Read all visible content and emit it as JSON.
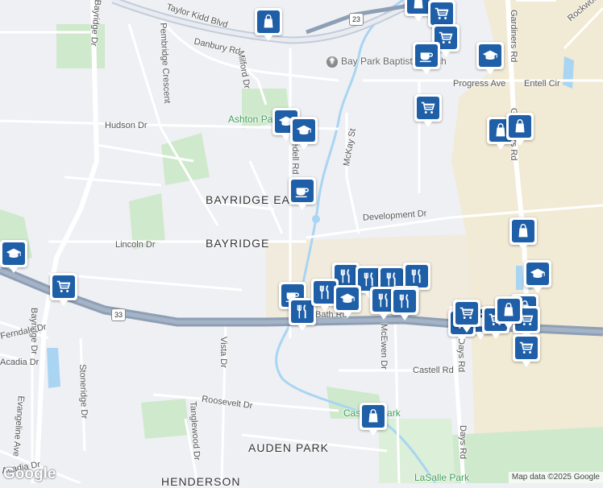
{
  "map": {
    "attribution": "Map data ©2025 Google",
    "logo": "Google",
    "colors": {
      "background": "#eef0f4",
      "park": "#c6e8c4",
      "water": "#a9d5f2",
      "highway": "#8e9fb5",
      "marker": "#1e5fa8",
      "industrial": "#efe6cd"
    },
    "area_labels": [
      "BAYRIDGE EAST",
      "BAYRIDGE",
      "AUDEN PARK",
      "HENDERSON"
    ],
    "park_labels": [
      "Ashton Park",
      "Cassidy Park",
      "LaSalle Park"
    ],
    "place_labels": [
      "Bay Park Baptist Church"
    ],
    "highway_shields": [
      "23",
      "33"
    ],
    "streets": {
      "taylor_kidd": "Taylor Kidd Blvd",
      "danbury": "Danbury Rd",
      "milford": "Milford Dr",
      "pembridge": "Pembridge Crescent",
      "bayridge_n": "Bayridge Dr",
      "bayridge_s": "Bayridge Dr",
      "hudson": "Hudson Dr",
      "truedell": "Truedell Rd",
      "mckay": "McKay St",
      "development": "Development Dr",
      "lincoln": "Lincoln Dr",
      "progress": "Progress Ave",
      "entell": "Entell Cir",
      "gardiners_n": "Gardiners Rd",
      "gardiners_s": "Gardiners Rd",
      "rockwood": "Rockwood",
      "bath": "Bath Rd",
      "mcewen": "McEwen Dr",
      "castell": "Castell Rd",
      "days_n": "Days Rd",
      "days_s": "Days Rd",
      "vista": "Vista Dr",
      "roosevelt": "Roosevelt Dr",
      "tanglewood": "Tanglewood Dr",
      "stoneridge": "Stoneridge Dr",
      "evangeline": "Evangeline Ave",
      "acadia_w": "Acadia Dr",
      "acadia_s": "Acadia Dr",
      "ferndale": "Ferndale Dr"
    },
    "markers": [
      {
        "icon": "shopping-bag-icon"
      },
      {
        "icon": "shopping-bag-icon"
      },
      {
        "icon": "shopping-cart-icon"
      },
      {
        "icon": "shopping-cart-icon"
      },
      {
        "icon": "coffee-cup-icon"
      },
      {
        "icon": "graduation-cap-icon"
      },
      {
        "icon": "shopping-cart-icon"
      },
      {
        "icon": "shopping-bag-icon"
      },
      {
        "icon": "shopping-bag-icon"
      },
      {
        "icon": "graduation-cap-icon"
      },
      {
        "icon": "graduation-cap-icon"
      },
      {
        "icon": "coffee-cup-icon"
      },
      {
        "icon": "shopping-bag-icon"
      },
      {
        "icon": "graduation-cap-icon"
      },
      {
        "icon": "shopping-cart-icon"
      },
      {
        "icon": "graduation-cap-icon"
      },
      {
        "icon": "restaurant-icon"
      },
      {
        "icon": "restaurant-icon"
      },
      {
        "icon": "restaurant-icon"
      },
      {
        "icon": "restaurant-icon"
      },
      {
        "icon": "restaurant-icon"
      },
      {
        "icon": "coffee-cup-icon"
      },
      {
        "icon": "restaurant-icon"
      },
      {
        "icon": "restaurant-icon"
      },
      {
        "icon": "graduation-cap-icon"
      },
      {
        "icon": "restaurant-icon"
      },
      {
        "icon": "restaurant-icon"
      },
      {
        "icon": "shopping-bag-icon"
      },
      {
        "icon": "shopping-cart-icon"
      },
      {
        "icon": "shopping-bag-icon"
      },
      {
        "icon": "shopping-cart-icon"
      },
      {
        "icon": "shopping-cart-icon"
      },
      {
        "icon": "shopping-cart-icon"
      },
      {
        "icon": "shopping-cart-icon"
      },
      {
        "icon": "shopping-bag-icon"
      },
      {
        "icon": "shopping-bag-icon"
      }
    ]
  }
}
